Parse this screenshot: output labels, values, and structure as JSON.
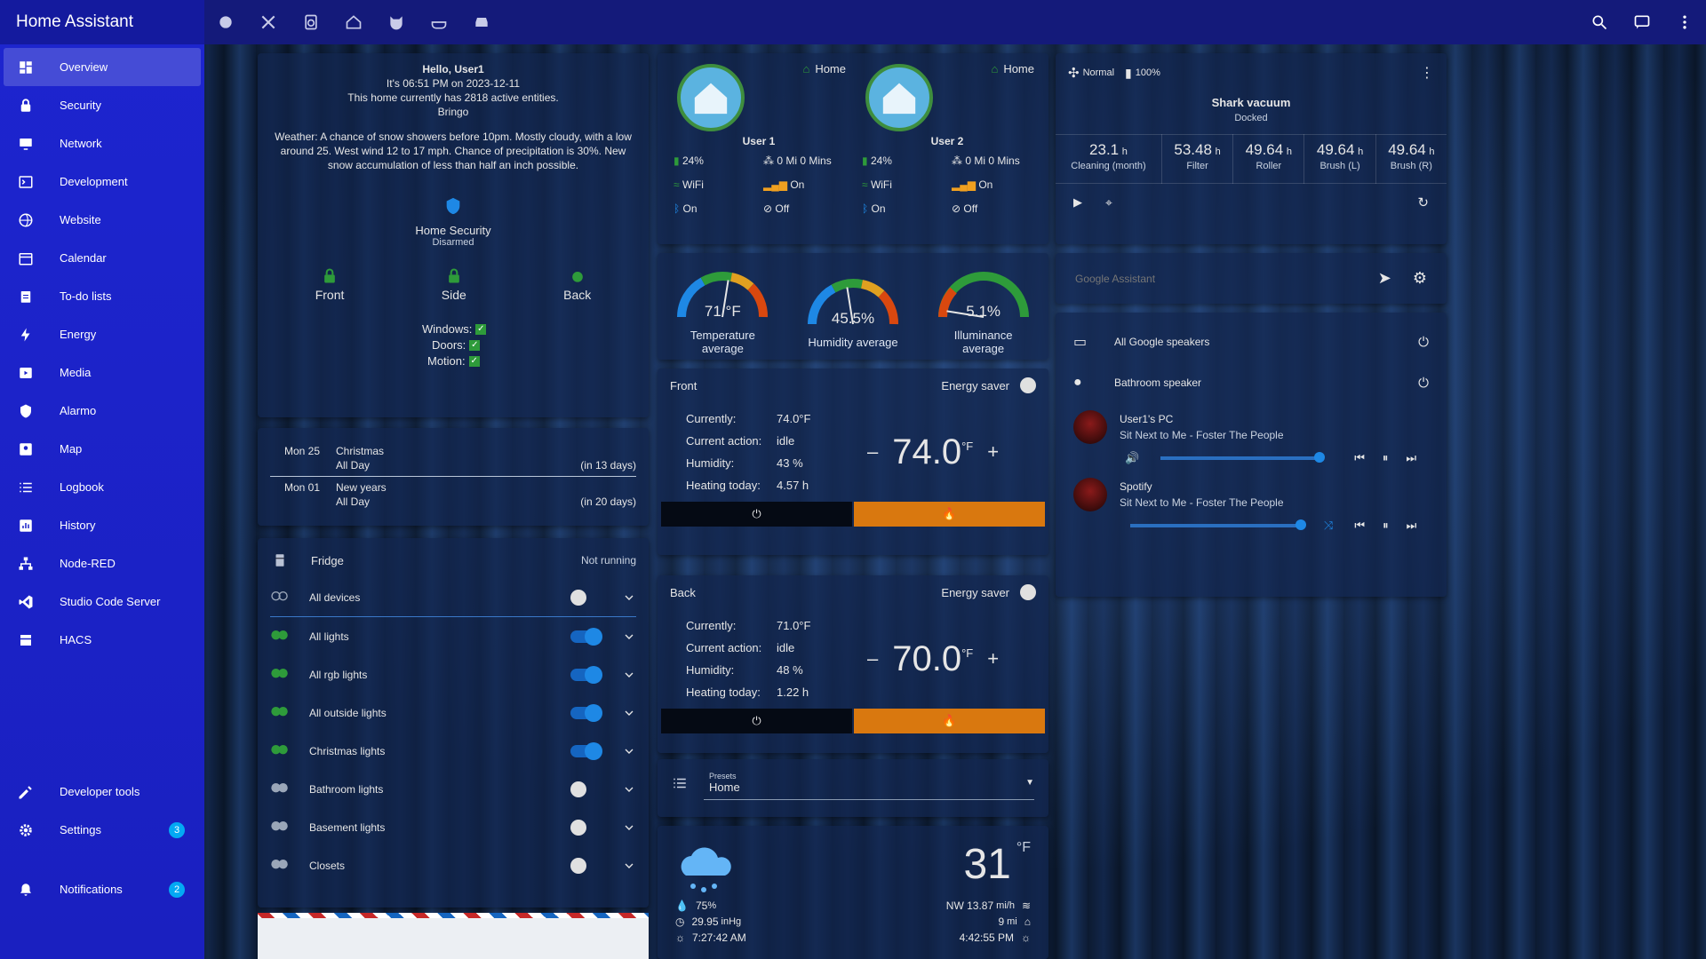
{
  "app": {
    "title": "Home Assistant"
  },
  "sidebar": {
    "items": [
      {
        "label": "Overview",
        "icon": "view-dashboard-icon",
        "active": true
      },
      {
        "label": "Security",
        "icon": "lock-icon"
      },
      {
        "label": "Network",
        "icon": "monitor-icon"
      },
      {
        "label": "Development",
        "icon": "terminal-icon"
      },
      {
        "label": "Website",
        "icon": "web-icon"
      },
      {
        "label": "Calendar",
        "icon": "calendar-icon"
      },
      {
        "label": "To-do lists",
        "icon": "clipboard-list-icon"
      },
      {
        "label": "Energy",
        "icon": "lightning-icon"
      },
      {
        "label": "Media",
        "icon": "play-box-icon"
      },
      {
        "label": "Alarmo",
        "icon": "shield-home-icon"
      },
      {
        "label": "Map",
        "icon": "account-box-icon"
      },
      {
        "label": "Logbook",
        "icon": "format-list-icon"
      },
      {
        "label": "History",
        "icon": "chart-box-icon"
      },
      {
        "label": "Node-RED",
        "icon": "sitemap-icon"
      },
      {
        "label": "Studio Code Server",
        "icon": "vscode-icon"
      },
      {
        "label": "HACS",
        "icon": "hacs-icon"
      }
    ],
    "developer_tools": "Developer tools",
    "settings": "Settings",
    "settings_badge": "3",
    "notifications": "Notifications",
    "notifications_badge": "2"
  },
  "greeting": {
    "hello": "Hello, User1",
    "time": "It's 06:51 PM on 2023-12-11",
    "entities": "This home currently has 2818 active entities.",
    "bringo": "Bringo",
    "weather_text": "Weather: A chance of snow showers before 10pm. Mostly cloudy, with a low around 25. West wind 12 to 17 mph. Chance of precipitation is 30%. New snow accumulation of less than half an inch possible.",
    "security_title": "Home Security",
    "security_state": "Disarmed",
    "locks": [
      "Front",
      "Side",
      "Back"
    ],
    "windows": "Windows:",
    "doors": "Doors:",
    "motion": "Motion:"
  },
  "calendar": {
    "events": [
      {
        "day": "Mon 25",
        "title": "Christmas",
        "when": "All Day",
        "rel": "(in 13 days)"
      },
      {
        "day": "Mon 01",
        "title": "New years",
        "when": "All Day",
        "rel": "(in 20 days)"
      }
    ]
  },
  "lights": {
    "fridge": "Fridge",
    "fridge_state": "Not running",
    "rows": [
      {
        "label": "All devices",
        "on": false
      },
      {
        "label": "All lights",
        "on": true
      },
      {
        "label": "All rgb lights",
        "on": true
      },
      {
        "label": "All outside lights",
        "on": true
      },
      {
        "label": "Christmas lights",
        "on": true
      },
      {
        "label": "Bathroom lights",
        "on": false
      },
      {
        "label": "Basement lights",
        "on": false
      },
      {
        "label": "Closets",
        "on": false
      }
    ]
  },
  "persons": [
    {
      "name": "User 1",
      "home": "Home",
      "battery": "24%",
      "distance": "0 Mi 0 Mins",
      "wifi": "WiFi",
      "signal": "On",
      "bt": "On",
      "dnd": "Off"
    },
    {
      "name": "User 2",
      "home": "Home",
      "battery": "24%",
      "distance": "0 Mi 0 Mins",
      "wifi": "WiFi",
      "signal": "On",
      "bt": "On",
      "dnd": "Off"
    }
  ],
  "gauges": [
    {
      "value": "71 °F",
      "label1": "Temperature",
      "label2": "average",
      "fraction": 0.55
    },
    {
      "value": "45.5%",
      "label1": "Humidity average",
      "label2": "",
      "fraction": 0.45
    },
    {
      "value": "5.1%",
      "label1": "Illuminance",
      "label2": "average",
      "fraction": 0.05
    }
  ],
  "thermostats": [
    {
      "name": "Front",
      "energy_saver": "Energy saver",
      "currently_label": "Currently:",
      "currently": "74.0°F",
      "action_label": "Current action:",
      "action": "idle",
      "humidity_label": "Humidity:",
      "humidity": "43 %",
      "heating_label": "Heating today:",
      "heating": "4.57 h",
      "target": "74.0",
      "unit": "°F"
    },
    {
      "name": "Back",
      "energy_saver": "Energy saver",
      "currently_label": "Currently:",
      "currently": "71.0°F",
      "action_label": "Current action:",
      "action": "idle",
      "humidity_label": "Humidity:",
      "humidity": "48 %",
      "heating_label": "Heating today:",
      "heating": "1.22 h",
      "target": "70.0",
      "unit": "°F"
    }
  ],
  "presets": {
    "label": "Presets",
    "value": "Home"
  },
  "weather": {
    "temp": "31",
    "unit": "°F",
    "humidity": "75",
    "humidity_unit": "%",
    "pressure": "29.95",
    "pressure_unit": "inHg",
    "sunrise": "7:27:42 AM",
    "wind": "NW 13.87",
    "wind_unit": "mi/h",
    "visibility": "9",
    "visibility_unit": "mi",
    "sunset": "4:42:55 PM"
  },
  "vacuum": {
    "mode": "Normal",
    "battery": "100%",
    "name": "Shark vacuum",
    "state": "Docked",
    "stats": [
      {
        "value": "23.1",
        "unit": "h",
        "label": "Cleaning (month)"
      },
      {
        "value": "53.48",
        "unit": "h",
        "label": "Filter"
      },
      {
        "value": "49.64",
        "unit": "h",
        "label": "Roller"
      },
      {
        "value": "49.64",
        "unit": "h",
        "label": "Brush (L)"
      },
      {
        "value": "49.64",
        "unit": "h",
        "label": "Brush (R)"
      }
    ]
  },
  "assistant": {
    "placeholder": "Google Assistant"
  },
  "media": {
    "speakers": [
      {
        "name": "All Google speakers"
      },
      {
        "name": "Bathroom speaker"
      }
    ],
    "players": [
      {
        "name": "User1's PC",
        "track": "Sit Next to Me - Foster The People",
        "volume": 0.96
      },
      {
        "name": "Spotify",
        "track": "Sit Next to Me - Foster The People",
        "volume": 0.98
      }
    ]
  },
  "colors": {
    "accent": "#1a22c8",
    "orange": "#d9780f",
    "blue": "#1e88e5",
    "green": "#2e9b3a"
  }
}
